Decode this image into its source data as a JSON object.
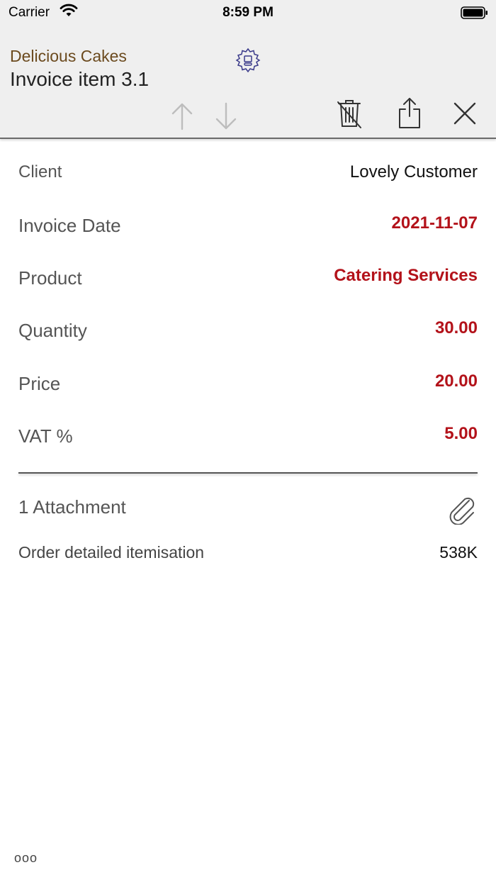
{
  "status_bar": {
    "carrier": "Carrier",
    "time": "8:59 PM"
  },
  "header": {
    "company": "Delicious Cakes",
    "title": "Invoice item 3.1",
    "icons": [
      "settings-gear-icon",
      "arrow-up-icon",
      "arrow-down-icon",
      "trash-icon",
      "share-icon",
      "close-icon"
    ]
  },
  "fields": [
    {
      "label": "Client",
      "value": "Lovely Customer"
    },
    {
      "label": "Invoice Date",
      "value": "2021-11-07"
    },
    {
      "label": "Product",
      "value": "Catering Services"
    },
    {
      "label": "Quantity",
      "value": "30.00"
    },
    {
      "label": "Price",
      "value": "20.00"
    },
    {
      "label": "VAT %",
      "value": "5.00"
    }
  ],
  "attachments": {
    "count_label": "1 Attachment",
    "items": [
      {
        "name": "Order detailed itemisation",
        "size": "538K"
      }
    ]
  },
  "footer": {
    "more_label": "ooo"
  },
  "colors": {
    "accent_red": "#b3121a",
    "company_brown": "#6b4a1e",
    "header_bg": "#efefef"
  }
}
